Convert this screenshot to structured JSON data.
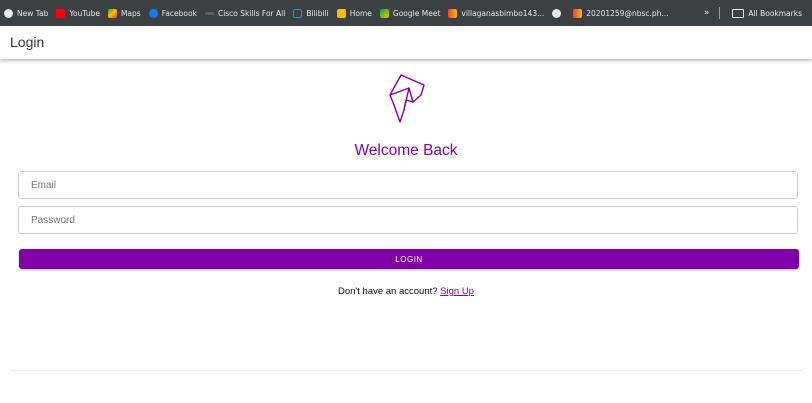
{
  "bookmarks": {
    "items": [
      {
        "label": "New Tab",
        "icon": "globe-icon",
        "color": "#e8eaed"
      },
      {
        "label": "YouTube",
        "icon": "youtube-icon",
        "color": "#ff0000"
      },
      {
        "label": "Maps",
        "icon": "maps-icon",
        "color": "#34a853"
      },
      {
        "label": "Facebook",
        "icon": "facebook-icon",
        "color": "#1877f2"
      },
      {
        "label": "Cisco Skills For All",
        "icon": "cisco-icon",
        "color": "#5f6368"
      },
      {
        "label": "Bilibili",
        "icon": "bilibili-icon",
        "color": "#00a1d6"
      },
      {
        "label": "Home",
        "icon": "home-icon",
        "color": "#fbbc04"
      },
      {
        "label": "Google Meet",
        "icon": "google-meet-icon",
        "color": "#00ac47"
      },
      {
        "label": "villaganasbimbo143...",
        "icon": "gmail-icon",
        "color": "#ea4335"
      },
      {
        "label": "",
        "icon": "globe-icon",
        "color": "#e8eaed"
      },
      {
        "label": "20201259@nbsc.ph...",
        "icon": "gmail-icon",
        "color": "#ea4335"
      }
    ],
    "overflow": "»",
    "all_bookmarks": "All Bookmarks"
  },
  "appbar": {
    "title": "Login"
  },
  "logo": {
    "icon": "paper-plane-logo-icon",
    "color": "#8000a8"
  },
  "form": {
    "heading": "Welcome Back",
    "email_placeholder": "Email",
    "password_placeholder": "Password",
    "login_label": "LOGIN",
    "signup_prompt": "Don't have an account?",
    "signup_link": "Sign Up"
  },
  "colors": {
    "accent": "#8000a8",
    "button": "#7f00a8",
    "bookmarks_bg": "#3c4043"
  }
}
